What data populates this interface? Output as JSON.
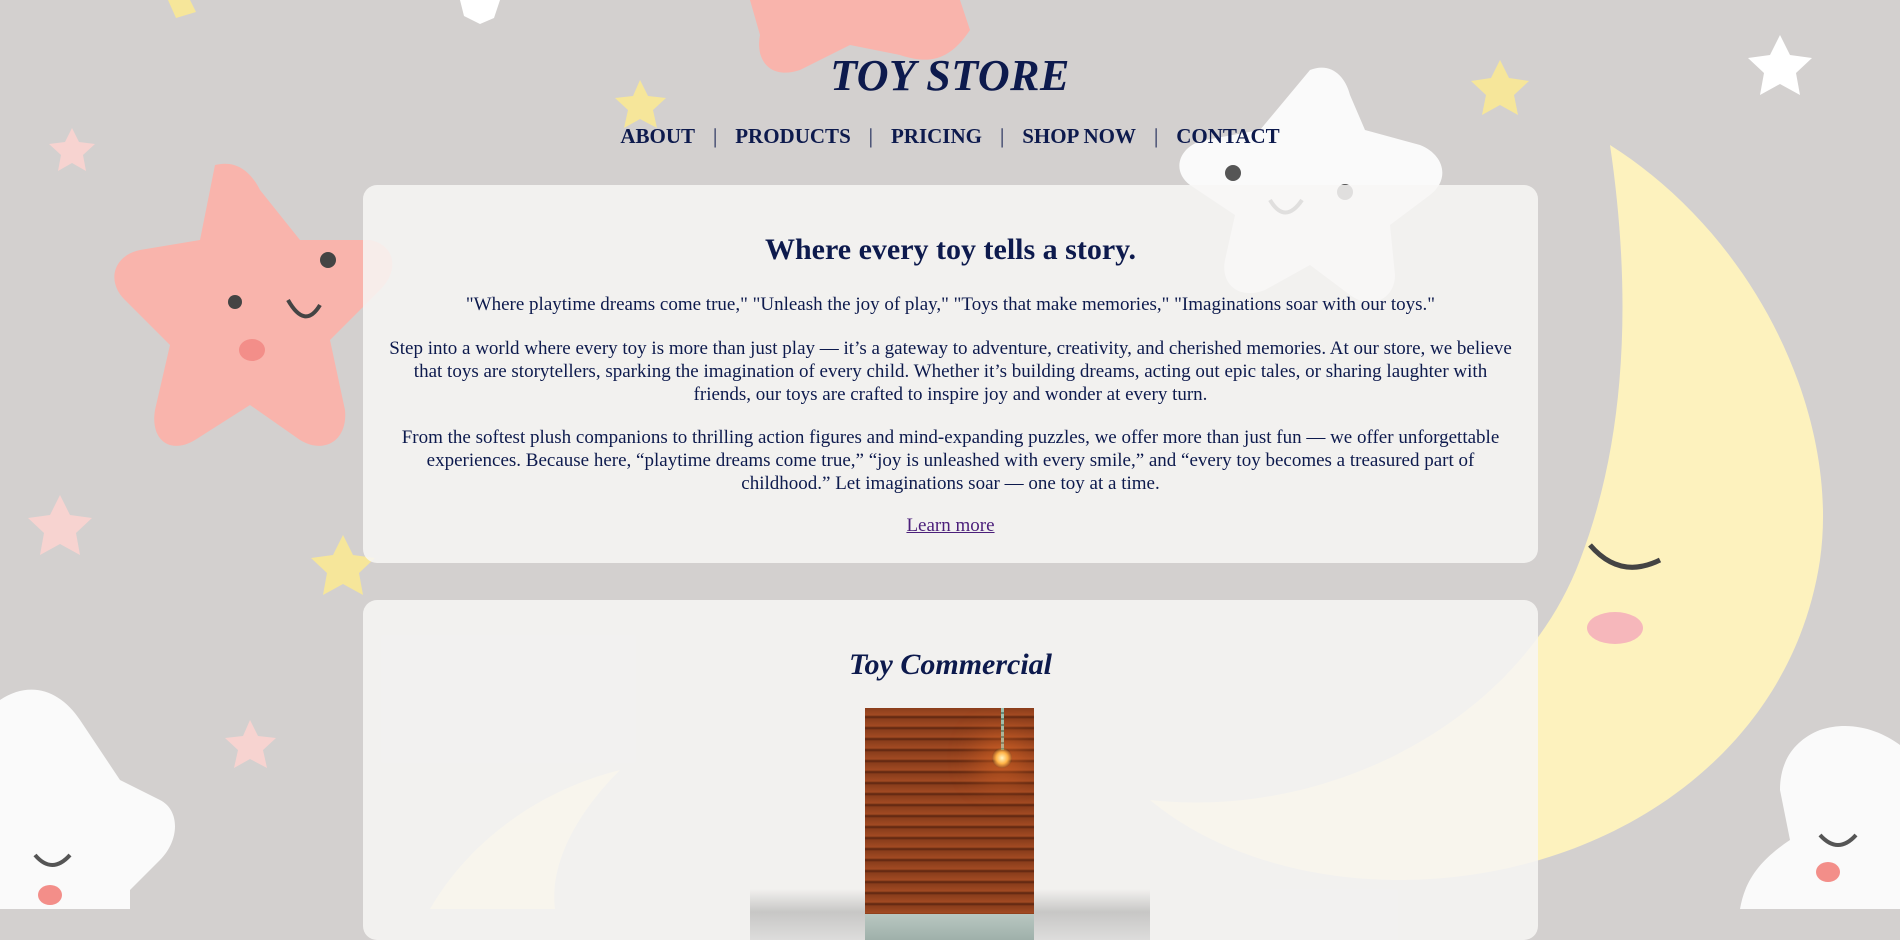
{
  "site": {
    "title": "TOY STORE"
  },
  "nav": {
    "items": [
      "ABOUT",
      "PRODUCTS",
      "PRICING",
      "SHOP NOW",
      "CONTACT"
    ],
    "separator": "|"
  },
  "intro": {
    "heading": "Where every toy tells a story.",
    "slogans": "\"Where playtime dreams come true,\" \"Unleash the joy of play,\" \"Toys that make memories,\" \"Imaginations soar with our toys.\"",
    "paragraph1": "Step into a world where every toy is more than just play — it’s a gateway to adventure, creativity, and cherished memories. At our store, we believe that toys are storytellers, sparking the imagination of every child. Whether it’s building dreams, acting out epic tales, or sharing laughter with friends, our toys are crafted to inspire joy and wonder at every turn.",
    "paragraph2": "From the softest plush companions to thrilling action figures and mind-expanding puzzles, we offer more than just fun — we offer unforgettable experiences. Because here, “playtime dreams come true,” “joy is unleashed with every smile,” and “every toy becomes a treasured part of childhood.” Let imaginations soar — one toy at a time.",
    "link_label": "Learn more"
  },
  "commercial": {
    "heading": "Toy Commercial"
  },
  "colors": {
    "background": "#d3d0cf",
    "text": "#0d1a4d",
    "link": "#4b1f7a",
    "card": "#f7f6f5"
  }
}
